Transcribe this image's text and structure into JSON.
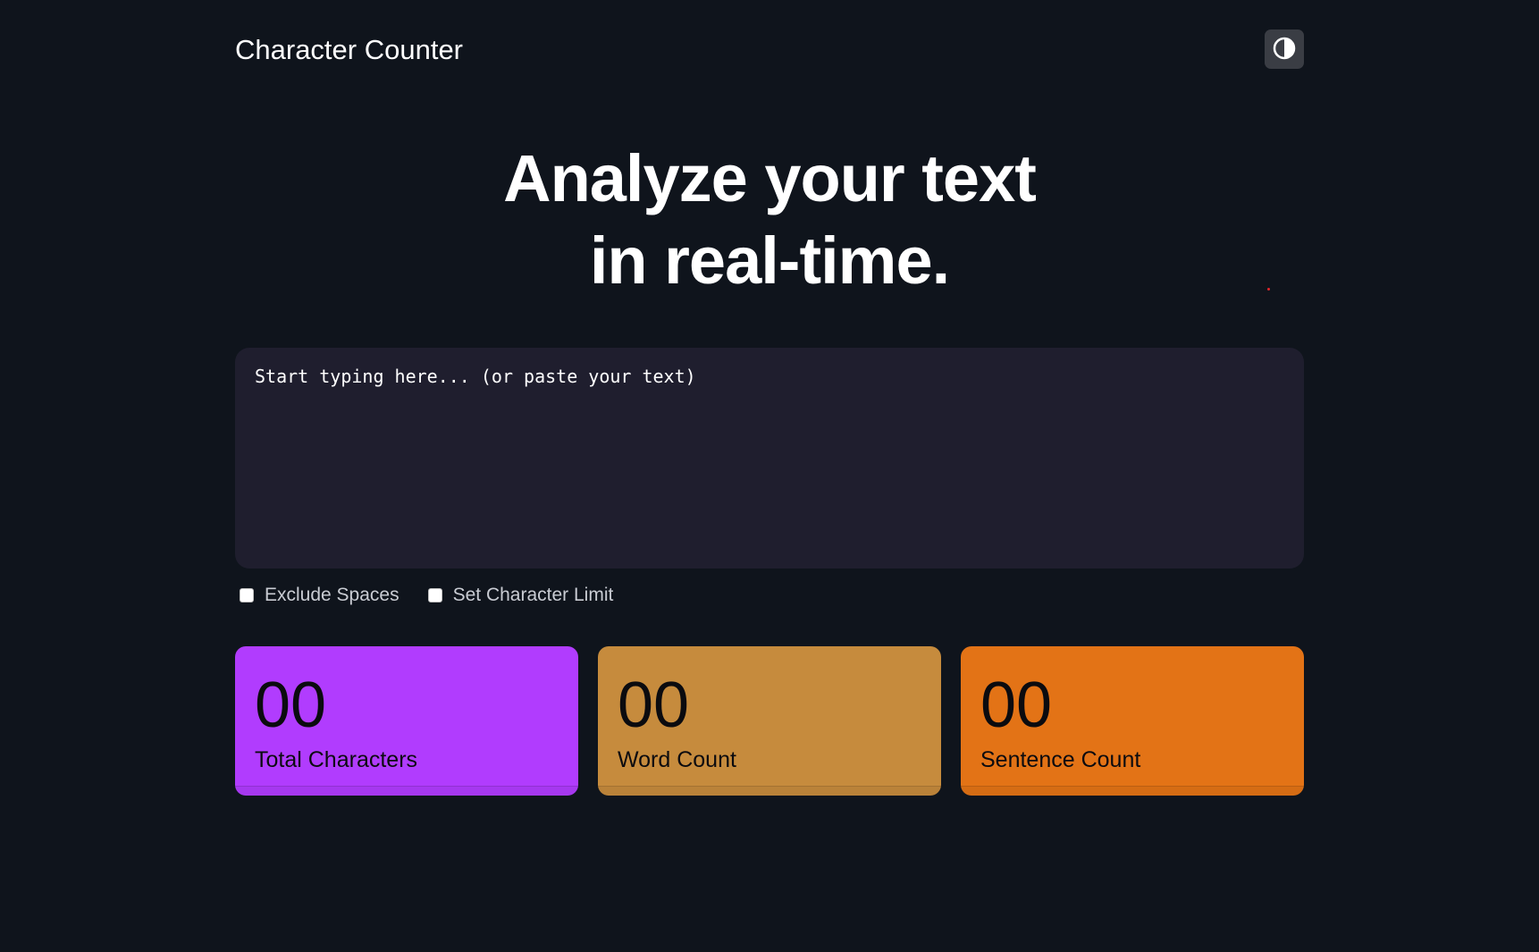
{
  "header": {
    "app_title": "Character Counter",
    "theme_toggle_icon": "contrast-icon"
  },
  "hero": {
    "line1": "Analyze your text",
    "line2": "in real-time."
  },
  "editor": {
    "placeholder": "Start typing here... (or paste your text)",
    "value": ""
  },
  "options": {
    "exclude_spaces": {
      "label": "Exclude Spaces",
      "checked": false
    },
    "set_limit": {
      "label": "Set Character Limit",
      "checked": false
    }
  },
  "stats": {
    "total_characters": {
      "value": "00",
      "label": "Total Characters",
      "color": "#b13cfe"
    },
    "word_count": {
      "value": "00",
      "label": "Word Count",
      "color": "#c68b3d"
    },
    "sentence_count": {
      "value": "00",
      "label": "Sentence Count",
      "color": "#e37316"
    }
  },
  "colors": {
    "background": "#0f141c",
    "editor_background": "#1f1e2e",
    "toggle_background": "#3a3d44"
  }
}
